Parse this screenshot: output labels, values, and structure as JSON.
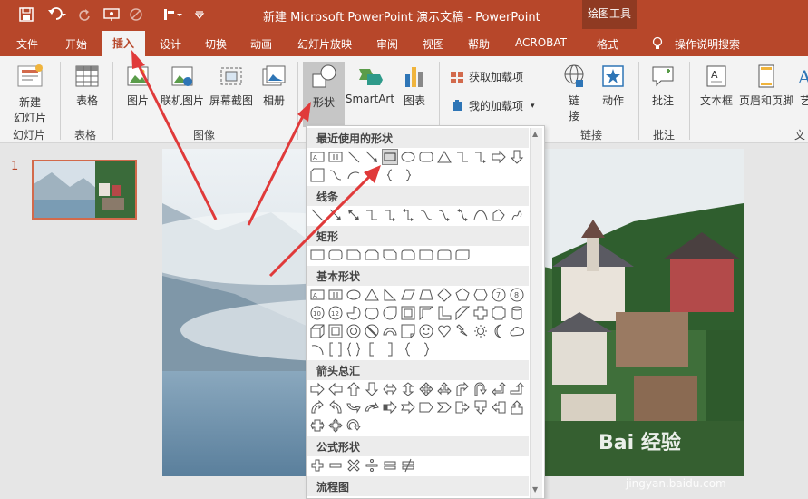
{
  "titlebar": {
    "title": "新建 Microsoft PowerPoint 演示文稿 - PowerPoint",
    "context_tab_group": "绘图工具"
  },
  "tabs": [
    "文件",
    "开始",
    "插入",
    "设计",
    "切换",
    "动画",
    "幻灯片放映",
    "审阅",
    "视图",
    "帮助",
    "ACROBAT",
    "格式"
  ],
  "active_tab": "插入",
  "tell_me": "操作说明搜索",
  "ribbon": {
    "new_slide": "新建\n幻灯片",
    "new_slide_line1": "新建",
    "new_slide_line2": "幻灯片",
    "table": "表格",
    "picture": "图片",
    "online_picture": "联机图片",
    "screenshot": "屏幕截图",
    "album": "相册",
    "shapes": "形状",
    "smartart": "SmartArt",
    "chart": "图表",
    "get_addins": "获取加载项",
    "my_addins": "我的加载项",
    "link_line1": "链",
    "link_line2": "接",
    "action": "动作",
    "comment": "批注",
    "textbox": "文本框",
    "header_footer": "页眉和页脚",
    "text_partial": "艺",
    "groups": {
      "slides": "幻灯片",
      "tables": "表格",
      "images": "图像",
      "links": "链接",
      "comments": "批注",
      "text": "文"
    }
  },
  "thumbnails": {
    "slide_number": "1"
  },
  "dropdown": {
    "sections": [
      "最近使用的形状",
      "线条",
      "矩形",
      "基本形状",
      "箭头总汇",
      "公式形状",
      "流程图"
    ]
  },
  "watermark": {
    "brand": "Bai 经验",
    "url": "jingyan.baidu.com"
  },
  "colors": {
    "accent": "#b7472a",
    "context_tab": "#8f3a22",
    "arrow": "#e03a3a"
  }
}
